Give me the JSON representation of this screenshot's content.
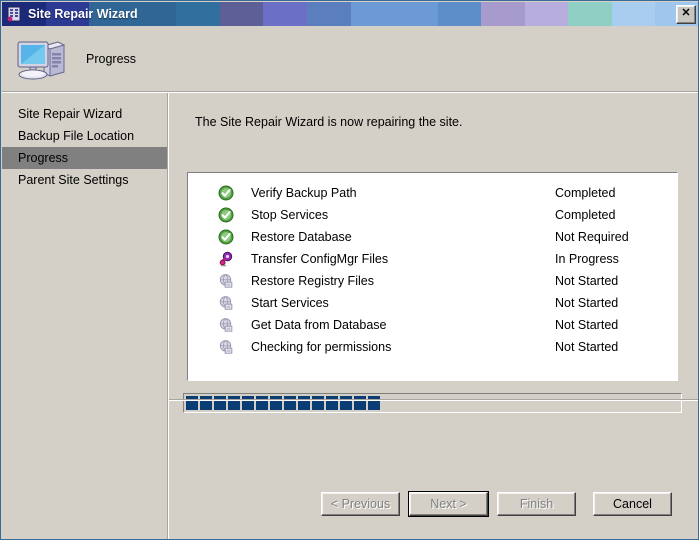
{
  "window": {
    "title": "Site Repair Wizard",
    "titlebar_icon": "wizard-app-icon",
    "close_label": "✕",
    "titlebar_bands": [
      "#1c2a7a",
      "#2c3a94",
      "#2f6696",
      "#31709e",
      "#5d5f96",
      "#6b6fc6",
      "#5b7fbe",
      "#6b9ad4",
      "#5d8ec9",
      "#a79bce",
      "#b7aede",
      "#8fcfc4",
      "#a8cdee",
      "#9fc6ec"
    ]
  },
  "header": {
    "title": "Progress",
    "icon": "computer-monitor-icon"
  },
  "sidebar": {
    "items": [
      {
        "label": "Site Repair Wizard",
        "selected": false
      },
      {
        "label": "Backup File Location",
        "selected": false
      },
      {
        "label": "Progress",
        "selected": true
      },
      {
        "label": "Parent Site Settings",
        "selected": false
      }
    ]
  },
  "main": {
    "instruction": "The Site Repair Wizard is now repairing the site.",
    "tasks": [
      {
        "label": "Verify Backup Path",
        "status": "Completed",
        "icon": "green-check-circle-icon"
      },
      {
        "label": "Stop Services",
        "status": "Completed",
        "icon": "green-check-circle-icon"
      },
      {
        "label": "Restore Database",
        "status": "Not Required",
        "icon": "green-check-circle-icon"
      },
      {
        "label": "Transfer ConfigMgr Files",
        "status": "In Progress",
        "icon": "purple-swirl-progress-icon"
      },
      {
        "label": "Restore Registry Files",
        "status": "Not Started",
        "icon": "gray-globe-pending-icon"
      },
      {
        "label": "Start Services",
        "status": "Not Started",
        "icon": "gray-globe-pending-icon"
      },
      {
        "label": "Get Data from Database",
        "status": "Not Started",
        "icon": "gray-globe-pending-icon"
      },
      {
        "label": "Checking for permissions",
        "status": "Not Started",
        "icon": "gray-globe-pending-icon"
      }
    ],
    "progress": {
      "filled_chunks": 14,
      "total_chunks": 35,
      "chunk_color": "#0a3d73"
    }
  },
  "footer": {
    "buttons": [
      {
        "label": "< Previous",
        "disabled": true,
        "default": false
      },
      {
        "label": "Next >",
        "disabled": true,
        "default": true
      },
      {
        "label": "Finish",
        "disabled": true,
        "default": false
      },
      {
        "label": "Cancel",
        "disabled": false,
        "default": false
      }
    ]
  }
}
